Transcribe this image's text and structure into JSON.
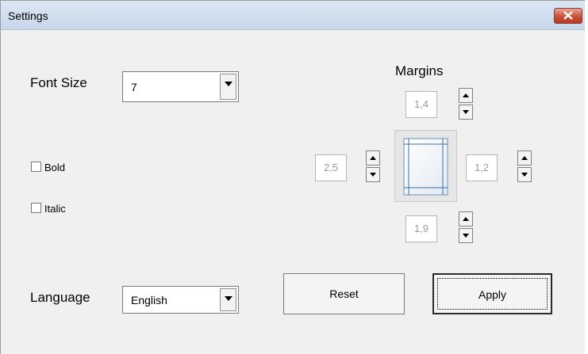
{
  "window": {
    "title": "Settings"
  },
  "font_size": {
    "label": "Font Size",
    "value": "7"
  },
  "bold": {
    "label": "Bold",
    "checked": false
  },
  "italic": {
    "label": "Italic",
    "checked": false
  },
  "margins": {
    "label": "Margins",
    "top": "1,4",
    "left": "2,5",
    "right": "1,2",
    "bottom": "1,9"
  },
  "language": {
    "label": "Language",
    "value": "English"
  },
  "buttons": {
    "reset": "Reset",
    "apply": "Apply"
  },
  "colors": {
    "titlebar": "#c7d7ea",
    "close": "#c7503a",
    "dialog_bg": "#f0f0f0"
  }
}
